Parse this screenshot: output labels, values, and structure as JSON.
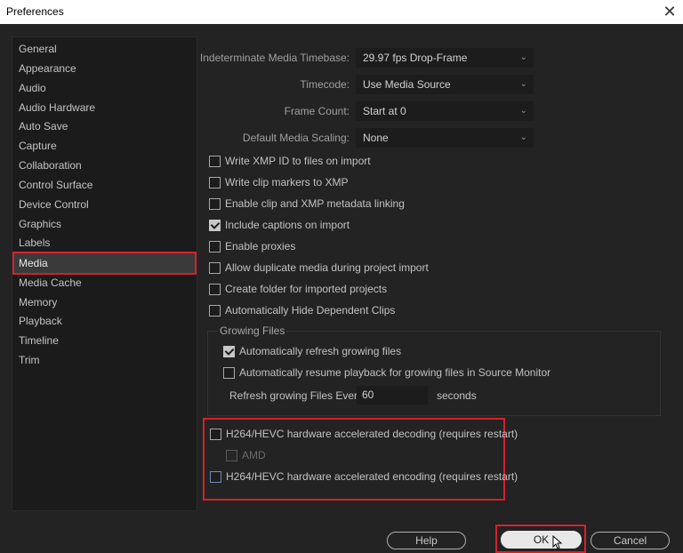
{
  "window": {
    "title": "Preferences",
    "close_glyph": "✕"
  },
  "sidebar": {
    "items": [
      {
        "label": "General"
      },
      {
        "label": "Appearance"
      },
      {
        "label": "Audio"
      },
      {
        "label": "Audio Hardware"
      },
      {
        "label": "Auto Save"
      },
      {
        "label": "Capture"
      },
      {
        "label": "Collaboration"
      },
      {
        "label": "Control Surface"
      },
      {
        "label": "Device Control"
      },
      {
        "label": "Graphics"
      },
      {
        "label": "Labels"
      },
      {
        "label": "Media",
        "selected": true
      },
      {
        "label": "Media Cache"
      },
      {
        "label": "Memory"
      },
      {
        "label": "Playback"
      },
      {
        "label": "Timeline"
      },
      {
        "label": "Trim"
      }
    ]
  },
  "media": {
    "timebase": {
      "label": "Indeterminate Media Timebase:",
      "value": "29.97 fps Drop-Frame"
    },
    "timecode": {
      "label": "Timecode:",
      "value": "Use Media Source"
    },
    "frame_count": {
      "label": "Frame Count:",
      "value": "Start at 0"
    },
    "scaling": {
      "label": "Default Media Scaling:",
      "value": "None"
    },
    "options": [
      {
        "label": "Write XMP ID to files on import",
        "checked": false
      },
      {
        "label": "Write clip markers to XMP",
        "checked": false
      },
      {
        "label": "Enable clip and XMP metadata linking",
        "checked": false
      },
      {
        "label": "Include captions on import",
        "checked": true
      },
      {
        "label": "Enable proxies",
        "checked": false
      },
      {
        "label": "Allow duplicate media during project import",
        "checked": false
      },
      {
        "label": "Create folder for imported projects",
        "checked": false
      },
      {
        "label": "Automatically Hide Dependent Clips",
        "checked": false
      }
    ],
    "growing_files": {
      "title": "Growing Files",
      "auto_refresh": {
        "label": "Automatically refresh growing files",
        "checked": true
      },
      "auto_resume": {
        "label": "Automatically resume playback for growing files in Source Monitor",
        "checked": false
      },
      "refresh_label": "Refresh growing Files Every",
      "refresh_value": "60",
      "refresh_unit": "seconds"
    },
    "hardware": {
      "decoding": {
        "label": "H264/HEVC hardware accelerated decoding (requires restart)",
        "checked": false
      },
      "amd": {
        "label": "AMD",
        "checked": false,
        "disabled": true
      },
      "encoding": {
        "label": "H264/HEVC hardware accelerated encoding (requires restart)",
        "checked": false
      }
    }
  },
  "buttons": {
    "help": "Help",
    "ok": "OK",
    "cancel": "Cancel"
  },
  "colors": {
    "highlight": "#d7202c",
    "background": "#232323"
  }
}
